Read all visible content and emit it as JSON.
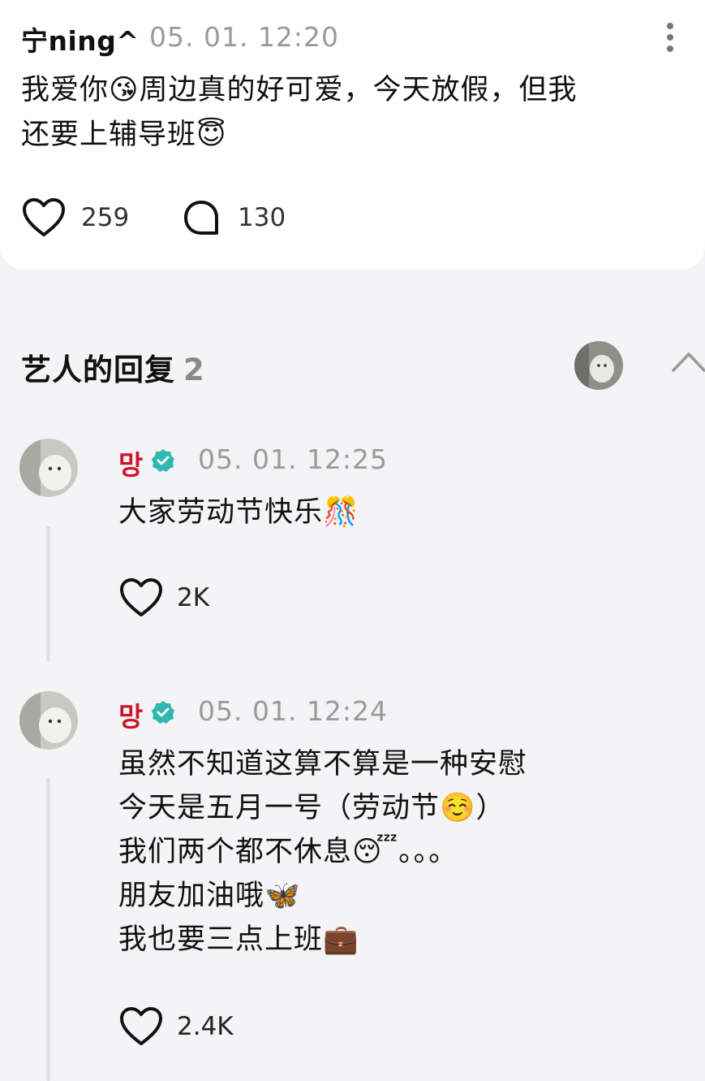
{
  "post": {
    "author": "宁ning^",
    "time": "05. 01. 12:20",
    "text_lines": [
      "我爱你😘周边真的好可爱，今天放假，但我",
      "还要上辅导班😇"
    ],
    "likes": "259",
    "comments": "130"
  },
  "replies_section": {
    "title": "艺人的回复",
    "count": "2"
  },
  "replies": [
    {
      "name": "망",
      "time": "05. 01. 12:25",
      "lines": [
        "大家劳动节快乐🎊"
      ],
      "likes": "2K"
    },
    {
      "name": "망",
      "time": "05. 01. 12:24",
      "lines": [
        "虽然不知道这算不算是一种安慰",
        "今天是五月一号（劳动节☺️）",
        "我们两个都不休息😴。。。",
        "朋友加油哦🦋",
        "我也要三点上班💼"
      ],
      "likes": "2.4K"
    }
  ],
  "colors": {
    "name_red": "#d0152a",
    "verified_teal": "#2fb7b0",
    "muted": "#9a9a9a"
  },
  "icons": [
    "more-vertical-icon",
    "heart-icon",
    "comment-bubble-icon",
    "chevron-up-icon",
    "verified-badge-icon",
    "avatar"
  ]
}
